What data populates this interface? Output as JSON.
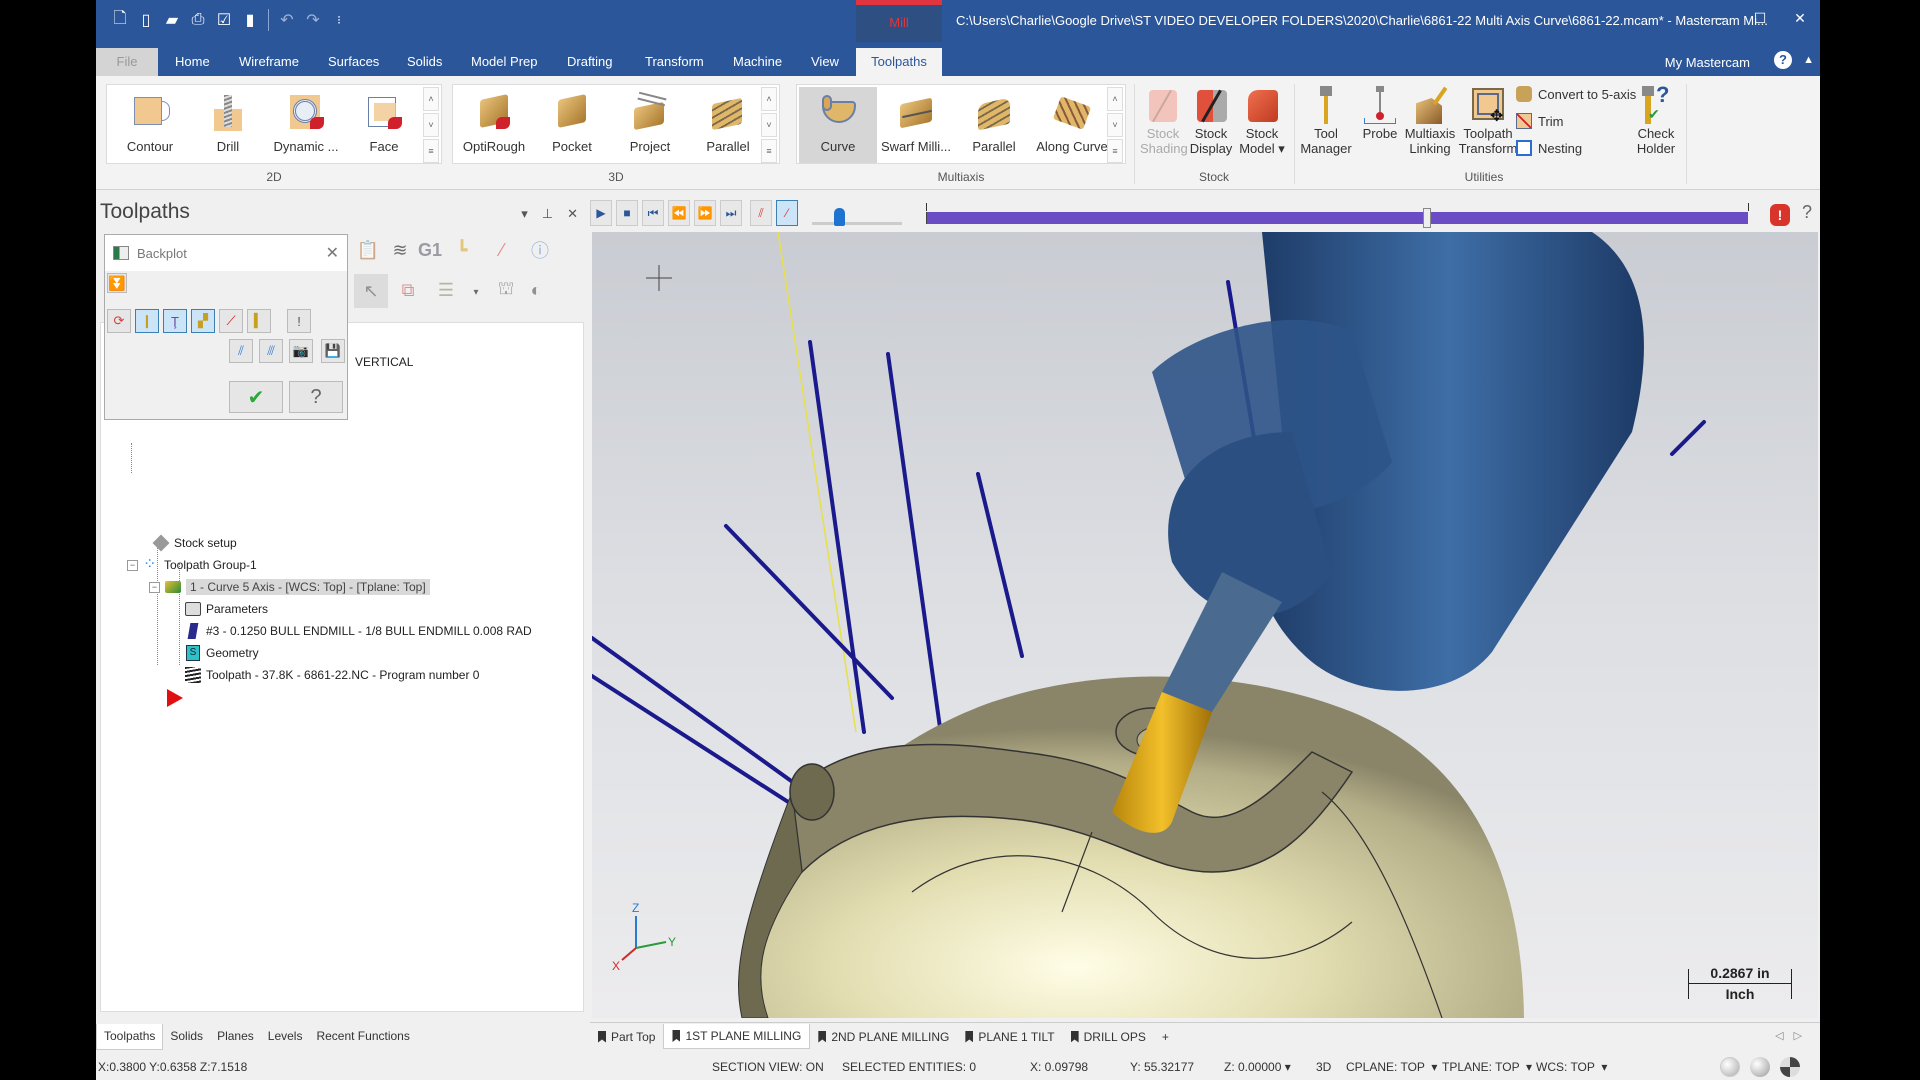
{
  "window": {
    "context_tab": "Mill",
    "title": "C:\\Users\\Charlie\\Google Drive\\ST VIDEO DEVELOPER FOLDERS\\2020\\Charlie\\6861-22 Multi Axis Curve\\6861-22.mcam* - Mastercam Mi...",
    "controls": {
      "minimize": "─",
      "maximize": "☐",
      "close": "✕"
    }
  },
  "quick_access": [
    "new-icon",
    "save-icon",
    "open-icon",
    "print-icon",
    "save-as-icon",
    "bookmark-icon",
    "undo-icon",
    "redo-icon",
    "customize-icon"
  ],
  "ribbon_tabs": [
    {
      "label": "File"
    },
    {
      "label": "Home"
    },
    {
      "label": "Wireframe"
    },
    {
      "label": "Surfaces"
    },
    {
      "label": "Solids"
    },
    {
      "label": "Model Prep"
    },
    {
      "label": "Drafting"
    },
    {
      "label": "Transform"
    },
    {
      "label": "Machine"
    },
    {
      "label": "View"
    },
    {
      "label": "Toolpaths",
      "active": true
    }
  ],
  "my_mastercam": "My Mastercam",
  "ribbon": {
    "groups": {
      "g2d": {
        "label": "2D",
        "buttons": [
          "Contour",
          "Drill",
          "Dynamic ...",
          "Face"
        ]
      },
      "g3d": {
        "label": "3D",
        "buttons": [
          "OptiRough",
          "Pocket",
          "Project",
          "Parallel"
        ]
      },
      "multiaxis": {
        "label": "Multiaxis",
        "buttons": [
          "Curve",
          "Swarf Milli...",
          "Parallel",
          "Along Curve"
        ],
        "selected": "Curve"
      },
      "stock": {
        "label": "Stock",
        "buttons": [
          {
            "line1": "Stock",
            "line2": "Shading",
            "disabled": true
          },
          {
            "line1": "Stock",
            "line2": "Display"
          },
          {
            "line1": "Stock",
            "line2": "Model ▾"
          }
        ]
      },
      "utilities": {
        "label": "Utilities",
        "buttons": [
          {
            "line1": "Tool",
            "line2": "Manager"
          },
          {
            "line1": "Probe",
            "line2": ""
          },
          {
            "line1": "Multiaxis",
            "line2": "Linking"
          },
          {
            "line1": "Toolpath",
            "line2": "Transform"
          }
        ],
        "small_buttons": [
          "Convert to 5-axis",
          "Trim",
          "Nesting"
        ],
        "check_holder": {
          "line1": "Check",
          "line2": "Holder"
        }
      }
    }
  },
  "panel": {
    "title": "Toolpaths",
    "controls": {
      "dropdown": "▾",
      "pin": "⊥",
      "close": "✕"
    },
    "toolbar_text_g1": "G1",
    "vertical_label": "VERTICAL",
    "tree": [
      {
        "label": "Stock setup"
      },
      {
        "label": "Toolpath Group-1"
      },
      {
        "label": "1 - Curve 5 Axis - [WCS: Top] - [Tplane: Top]",
        "selected": true
      },
      {
        "label": "Parameters"
      },
      {
        "label": "#3 - 0.1250 BULL ENDMILL - 1/8 BULL ENDMILL 0.008 RAD"
      },
      {
        "label": "Geometry"
      },
      {
        "label": "Toolpath - 37.8K - 6861-22.NC - Program number 0"
      }
    ],
    "bottom_tabs": [
      "Toolpaths",
      "Solids",
      "Planes",
      "Levels",
      "Recent Functions"
    ],
    "active_bottom_tab": "Toolpaths"
  },
  "backplot": {
    "title": "Backplot",
    "ok": "✔",
    "help": "?"
  },
  "playback": {
    "progress_fraction": 0.61,
    "speed_fraction": 0.3
  },
  "viewport": {
    "scale_value": "0.2867 in",
    "scale_unit": "Inch",
    "axis": {
      "z": "Z",
      "x": "X",
      "y": "Y"
    }
  },
  "viewsheets": {
    "tabs": [
      "Part Top",
      "1ST PLANE MILLING",
      "2ND PLANE MILLING",
      "PLANE 1 TILT",
      "DRILL OPS"
    ],
    "active": "1ST PLANE MILLING",
    "add": "+"
  },
  "status": {
    "cursor": "X:0.3800  Y:0.6358  Z:7.1518",
    "section_view": "SECTION VIEW: ON",
    "selected": "SELECTED ENTITIES: 0",
    "x": "X:  0.09798",
    "y": "Y:  55.32177",
    "z": "Z:  0.00000",
    "mode": "3D",
    "cplane": "CPLANE: TOP",
    "tplane": "TPLANE: TOP",
    "wcs": "WCS: TOP"
  },
  "colors": {
    "accent": "#2b579a",
    "context_red": "#e0353f",
    "progress": "#6a4cc4",
    "toolpath_lines": "#1a1a8c",
    "part": "#e6e2b8",
    "holder": "#24497a",
    "tool": "#e0a90e"
  }
}
